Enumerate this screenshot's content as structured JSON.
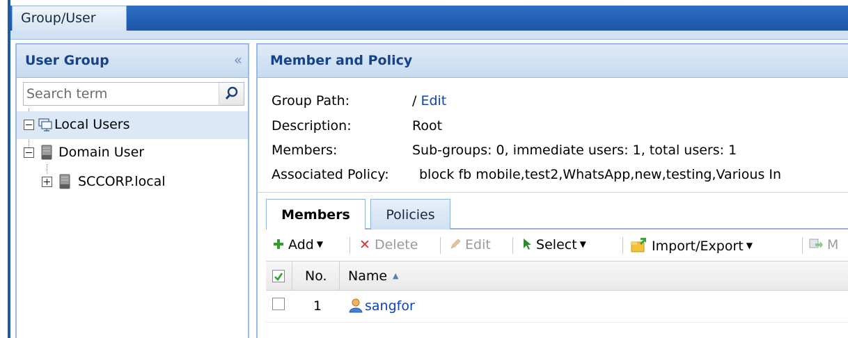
{
  "top_tab": {
    "label": "Group/User"
  },
  "left_panel": {
    "title": "User Group",
    "search": {
      "placeholder": "Search term",
      "value": ""
    },
    "tree": [
      {
        "label": "Local Users",
        "expanded": true,
        "selected": true,
        "icon": "local-users-icon"
      },
      {
        "label": "Domain User",
        "expanded": true,
        "selected": false,
        "icon": "server-icon"
      },
      {
        "label": "SCCORP.local",
        "expanded": false,
        "selected": false,
        "icon": "server-icon"
      }
    ]
  },
  "right_panel": {
    "title": "Member and Policy",
    "info": {
      "group_path_label": "Group Path:",
      "group_path_value": "/",
      "edit_link": "Edit",
      "description_label": "Description:",
      "description_value": "Root",
      "members_label": "Members:",
      "members_value": "Sub-groups: 0, immediate users: 1, total users: 1",
      "policy_label": "Associated Policy:",
      "policy_value": "block fb mobile,test2,WhatsApp,new,testing,Various In"
    },
    "tabs": [
      {
        "label": "Members",
        "active": true
      },
      {
        "label": "Policies",
        "active": false
      }
    ],
    "toolbar": {
      "add": "Add",
      "delete": "Delete",
      "edit": "Edit",
      "select": "Select",
      "import_export": "Import/Export",
      "more": "M"
    },
    "grid": {
      "columns": {
        "no": "No.",
        "name": "Name"
      },
      "rows": [
        {
          "no": "1",
          "name": "sangfor",
          "checked": false
        }
      ]
    }
  },
  "colors": {
    "accent_blue": "#1c56a9",
    "panel_border": "#99bbe8",
    "header_text": "#15428b",
    "link": "#0f43b8",
    "add_green": "#2e9e2e",
    "delete_red": "#d9332b"
  }
}
